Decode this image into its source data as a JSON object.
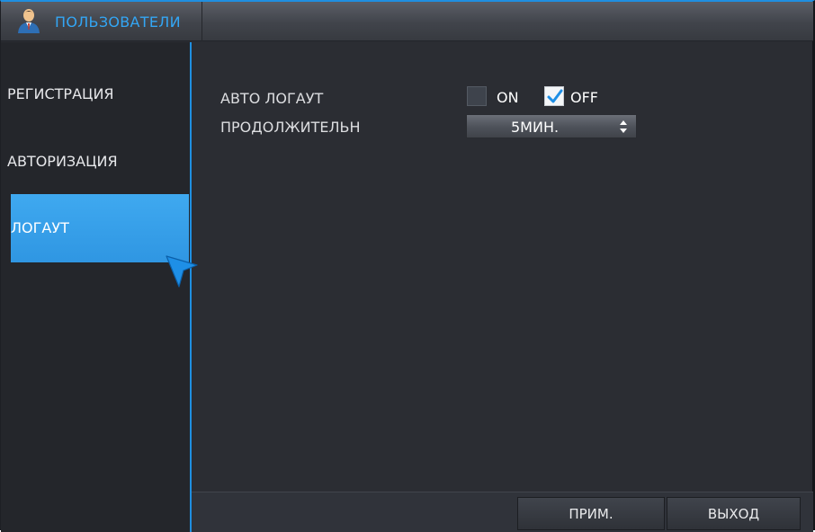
{
  "window": {
    "title": "ПОЛЬЗОВАТЕЛИ",
    "title_icon": "user-icon"
  },
  "sidebar": {
    "items": [
      {
        "label": "РЕГИСТРАЦИЯ",
        "active": false
      },
      {
        "label": "АВТОРИЗАЦИЯ",
        "active": false
      },
      {
        "label": "ЛОГАУТ",
        "active": true
      }
    ]
  },
  "form": {
    "auto_logout": {
      "label": "АВТО ЛОГАУТ",
      "on_label": "ON",
      "on_checked": false,
      "off_label": "OFF",
      "off_checked": true
    },
    "duration": {
      "label": "ПРОДОЛЖИТЕЛЬН",
      "value": "5МИН."
    }
  },
  "footer": {
    "apply_label": "ПРИМ.",
    "exit_label": "ВЫХОД"
  },
  "colors": {
    "accent": "#1f8fe0",
    "active_item": "#3fa9f0",
    "background": "#2b2d33",
    "check": "#1e8fe6"
  }
}
